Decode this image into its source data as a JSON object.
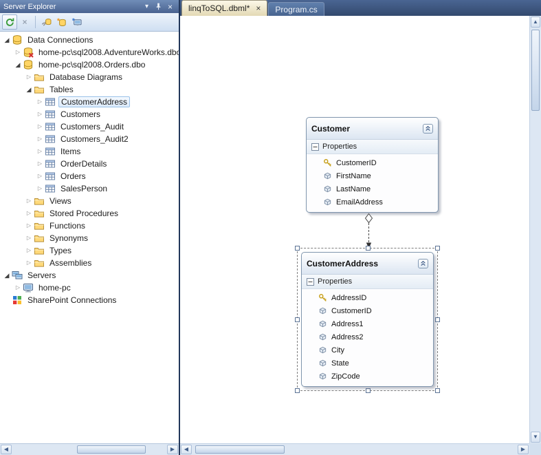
{
  "server_explorer": {
    "title": "Server Explorer",
    "toolbar": [
      {
        "name": "refresh"
      },
      {
        "name": "stop-refresh"
      },
      {
        "name": "connect-to-database"
      },
      {
        "name": "create-new-sql-database"
      },
      {
        "name": "connect-to-server"
      }
    ],
    "tree": [
      {
        "label": "Data Connections"
      },
      {
        "label": "home-pc\\sql2008.AdventureWorks.dbo"
      },
      {
        "label": "home-pc\\sql2008.Orders.dbo"
      },
      {
        "label": "Database Diagrams"
      },
      {
        "label": "Tables"
      },
      {
        "label": "CustomerAddress",
        "selected": true
      },
      {
        "label": "Customers"
      },
      {
        "label": "Customers_Audit"
      },
      {
        "label": "Customers_Audit2"
      },
      {
        "label": "Items"
      },
      {
        "label": "OrderDetails"
      },
      {
        "label": "Orders"
      },
      {
        "label": "SalesPerson"
      },
      {
        "label": "Views"
      },
      {
        "label": "Stored Procedures"
      },
      {
        "label": "Functions"
      },
      {
        "label": "Synonyms"
      },
      {
        "label": "Types"
      },
      {
        "label": "Assemblies"
      },
      {
        "label": "Servers"
      },
      {
        "label": "home-pc"
      },
      {
        "label": "SharePoint Connections"
      }
    ]
  },
  "tabs": [
    {
      "label": "linqToSQL.dbml*",
      "active": true,
      "close": "×"
    },
    {
      "label": "Program.cs",
      "active": false
    }
  ],
  "designer": {
    "entities": [
      {
        "title": "Customer",
        "section": "Properties",
        "properties": [
          "CustomerID",
          "FirstName",
          "LastName",
          "EmailAddress"
        ],
        "key_property": "CustomerID",
        "selected": false
      },
      {
        "title": "CustomerAddress",
        "section": "Properties",
        "properties": [
          "AddressID",
          "CustomerID",
          "Address1",
          "Address2",
          "City",
          "State",
          "ZipCode"
        ],
        "key_property": "AddressID",
        "selected": true
      }
    ]
  },
  "glyphs": {
    "collapsed": "▷",
    "expanded": "◢",
    "menu_down": "▾",
    "close": "×",
    "up": "▲",
    "down": "▼",
    "left": "◀",
    "right": "▶"
  },
  "colors": {
    "titlebar_top": "#708db8",
    "titlebar_bottom": "#4a6390",
    "tabstrip_bg": "#33496e",
    "active_tab_bg": "#f3eed8",
    "tree_selection_border": "#99c1e8",
    "key_icon": "#c9a21e",
    "db_icon": "#ffd566"
  }
}
